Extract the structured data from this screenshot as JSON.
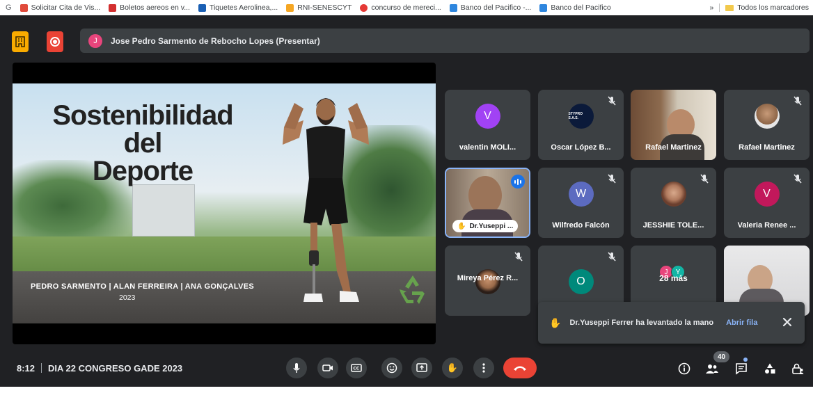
{
  "bookmarks": {
    "items": [
      {
        "label": "Solicitar Cita de Vis...",
        "color": "#e04a3b"
      },
      {
        "label": "Boletos aereos en v...",
        "color": "#d32f2f"
      },
      {
        "label": "Tiquetes Aerolinea,...",
        "color": "#1a5fb4"
      },
      {
        "label": "RNI-SENESCYT",
        "color": "#f5a623"
      },
      {
        "label": "concurso de mereci...",
        "color": "#e53935"
      },
      {
        "label": "Banco del Pacifico -...",
        "color": "#2e86de"
      },
      {
        "label": "Banco del Pacifico",
        "color": "#2e86de"
      }
    ],
    "overflow": "»",
    "all_bookmarks": "Todos los marcadores"
  },
  "header": {
    "presenter_initial": "J",
    "presenter_label": "Jose Pedro Sarmento de Rebocho Lopes (Presentar)",
    "accent_yellow": "#f9ab00",
    "accent_red": "#ea4335"
  },
  "slide": {
    "title_line1": "Sostenibilidad",
    "title_line2": "del",
    "title_line3": "Deporte",
    "authors": "PEDRO SARMENTO | ALAN FERREIRA | ANA GONÇALVES",
    "year": "2023"
  },
  "participants": [
    {
      "name": "valentin MOLI...",
      "initial": "V",
      "color": "#a142f4",
      "muted": false
    },
    {
      "name": "Oscar López B...",
      "initial": "",
      "logo_text": "STYPRO S.A.S.",
      "muted": true
    },
    {
      "name": "Rafael Martinez",
      "photo": true,
      "muted": false
    },
    {
      "name": "Rafael Martinez",
      "photo_avatar": true,
      "muted": true
    },
    {
      "name": "Dr.Yuseppi ...",
      "photo": true,
      "hand_raised": true,
      "speaking": true
    },
    {
      "name": "Wilfredo Falcón",
      "initial": "W",
      "color": "#5c6bc0",
      "muted": true
    },
    {
      "name": "JESSHIE TOLE...",
      "photo_avatar": true,
      "muted": true
    },
    {
      "name": "Valeria Renee ...",
      "initial": "V",
      "color": "#c2185b",
      "muted": true
    },
    {
      "name": "Mireya Pérez R...",
      "photo_avatar": true,
      "muted": true
    },
    {
      "name": "",
      "initial": "O",
      "color": "#00897b",
      "muted": true
    },
    {
      "name": "28 más",
      "stack": [
        {
          "initial": "J",
          "color": "#e8457c"
        },
        {
          "initial": "Y",
          "color": "#12b5a5"
        }
      ]
    },
    {
      "name": "",
      "photo": true
    }
  ],
  "toast": {
    "message": "Dr.Yuseppi Ferrer ha levantado la mano",
    "action": "Abrir fila"
  },
  "bottom": {
    "time": "8:12",
    "meeting_name": "DIA 22 CONGRESO GADE 2023",
    "people_count": "40",
    "end_call_color": "#ea4335"
  }
}
